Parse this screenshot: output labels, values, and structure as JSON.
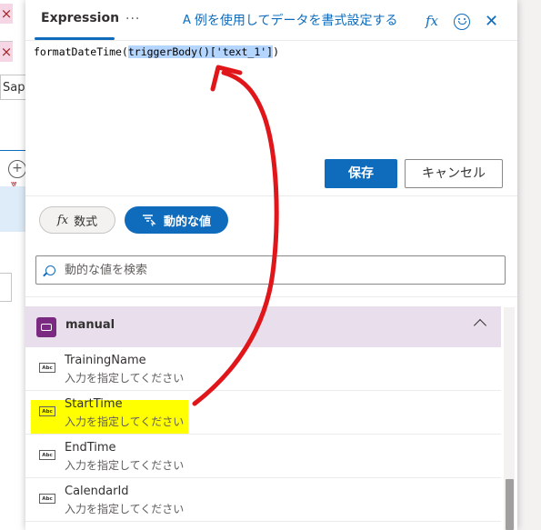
{
  "background": {
    "close_glyph": "×",
    "sapp_text": "Sapp",
    "plus_glyph": "+"
  },
  "header": {
    "tab_expression": "Expression",
    "more_glyph": "···",
    "format_link": "例を使用してデータを書式設定する",
    "format_icon_glyph": "A",
    "fx_label": "fx",
    "close_glyph": "✕"
  },
  "editor": {
    "code_prefix": "formatDateTime(",
    "code_selected": "triggerBody()['text_1']",
    "code_suffix": ")"
  },
  "actions": {
    "save_label": "保存",
    "cancel_label": "キャンセル"
  },
  "mode_tabs": {
    "formula_icon": "fx",
    "formula_label": "数式",
    "dynamic_label": "動的な値"
  },
  "search": {
    "placeholder": "動的な値を検索"
  },
  "group": {
    "name": "manual",
    "icon": "manual-trigger-icon"
  },
  "items": [
    {
      "title": "TrainingName",
      "desc": "入力を指定してください",
      "type_badge": "Abc"
    },
    {
      "title": "StartTime",
      "desc": "入力を指定してください",
      "type_badge": "Abc"
    },
    {
      "title": "EndTime",
      "desc": "入力を指定してください",
      "type_badge": "Abc"
    },
    {
      "title": "CalendarId",
      "desc": "入力を指定してください",
      "type_badge": "Abc"
    }
  ],
  "colors": {
    "accent": "#0f6cbd",
    "group_bg": "#e9dfec",
    "highlight": "#ffff00",
    "annotation_arrow": "#e0161b"
  }
}
